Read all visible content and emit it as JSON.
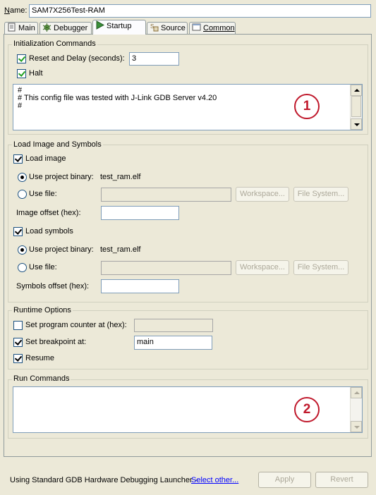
{
  "name_row": {
    "label": "Name:",
    "value": "SAM7X256Test-RAM"
  },
  "tabs": [
    {
      "label": "Main",
      "icon": "page-icon",
      "selected": false
    },
    {
      "label": "Debugger",
      "icon": "bug-icon",
      "selected": false
    },
    {
      "label": "Startup",
      "icon": "play-icon",
      "selected": true
    },
    {
      "label": "Source",
      "icon": "source-icon",
      "selected": false
    },
    {
      "label": "Common",
      "icon": "window-icon",
      "selected": false
    }
  ],
  "init": {
    "title": "Initialization Commands",
    "reset_label": "Reset and Delay (seconds):",
    "reset_checked": true,
    "delay_value": "3",
    "halt_label": "Halt",
    "halt_checked": true,
    "commands": "#\n# This config file was tested with J-Link GDB Server v4.20\n#"
  },
  "load": {
    "title": "Load Image and Symbols",
    "load_image_label": "Load image",
    "load_image_checked": true,
    "image_project_label": "Use project binary:",
    "image_project_value": "test_ram.elf",
    "image_file_label": "Use file:",
    "workspace_label": "Workspace...",
    "filesystem_label": "File System...",
    "image_offset_label": "Image offset (hex):",
    "load_symbols_label": "Load symbols",
    "load_symbols_checked": true,
    "symbols_project_label": "Use project binary:",
    "symbols_project_value": "test_ram.elf",
    "symbols_file_label": "Use file:",
    "symbols_offset_label": "Symbols offset (hex):"
  },
  "runtime": {
    "title": "Runtime Options",
    "set_pc_label": "Set program counter at (hex):",
    "set_pc_checked": false,
    "set_bp_label": "Set breakpoint at:",
    "set_bp_checked": true,
    "bp_value": "main",
    "resume_label": "Resume",
    "resume_checked": true
  },
  "run": {
    "title": "Run Commands",
    "commands": ""
  },
  "callouts": {
    "one": "1",
    "two": "2"
  },
  "footer": {
    "launcher_text": "Using Standard GDB Hardware Debugging Launcher -",
    "select_other": "Select other...",
    "apply": "Apply",
    "revert": "Revert"
  },
  "colors": {
    "background": "#ece9d8",
    "callout": "#c0192c",
    "link": "#0000ff",
    "check": "#21a121"
  }
}
